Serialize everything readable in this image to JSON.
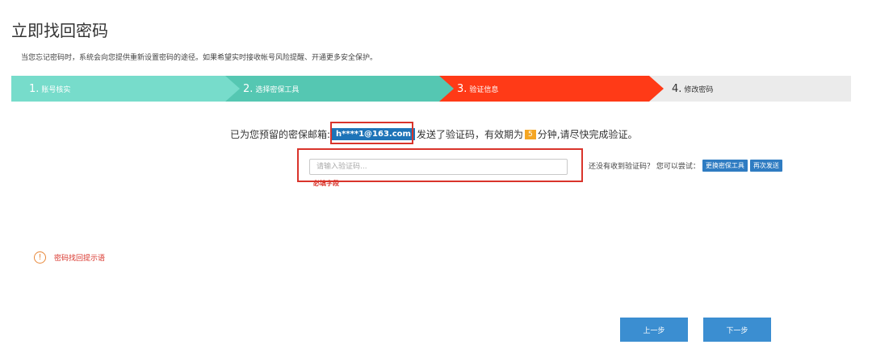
{
  "page": {
    "title": "立即找回密码",
    "subtitle": "当您忘记密码时，系统会向您提供重新设置密码的途径。如果希望实时接收帐号风险提醒、开通更多安全保护。"
  },
  "steps": [
    {
      "num": "1.",
      "label": "账号核实",
      "color": "#77dccb"
    },
    {
      "num": "2.",
      "label": "选择密保工具",
      "color": "#55c7b2"
    },
    {
      "num": "3.",
      "label": "验证信息",
      "color": "#ff3a17"
    },
    {
      "num": "4.",
      "label": "修改密码",
      "color": "#ebebeb"
    }
  ],
  "verification": {
    "prefix": "已为您预留的密保邮箱:",
    "email": "h****1@163.com",
    "middle": "发送了验证码，有效期为",
    "minutes": "5",
    "suffix": "分钟,请尽快完成验证。",
    "input_placeholder": "请输入验证码...",
    "input_value": "",
    "required_text": "必填字段"
  },
  "hint": {
    "text": "还没有收到验证码？ 您可以尝试：",
    "change_tool": "更换密保工具",
    "resend": "再次发送"
  },
  "tip": {
    "icon": "warning-circle-icon",
    "text": "密码找回提示语"
  },
  "nav": {
    "prev": "上一步",
    "next": "下一步"
  },
  "colors": {
    "accent_blue": "#3b8ed1",
    "error_red": "#d9342b"
  }
}
